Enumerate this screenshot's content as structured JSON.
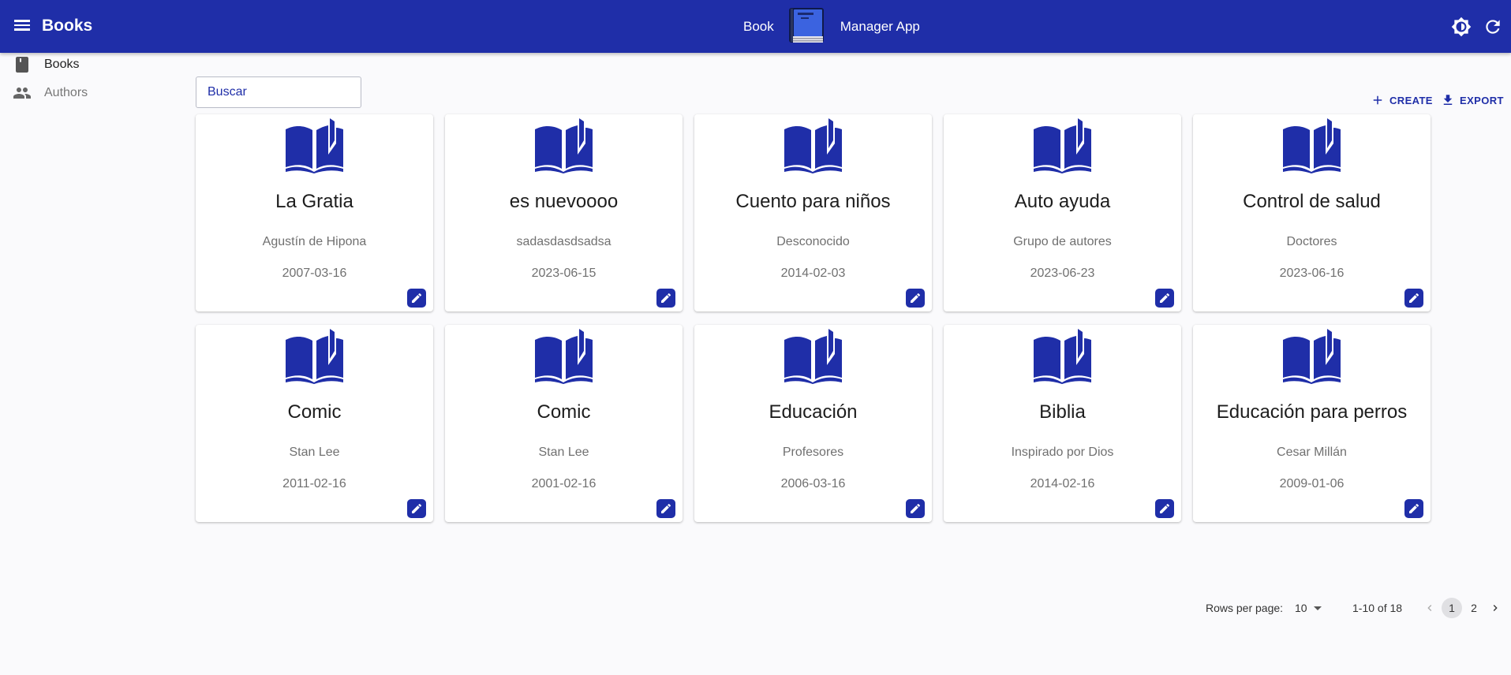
{
  "appbar": {
    "title": "Books",
    "center_left": "Book",
    "center_right": "Manager App",
    "icons": [
      "menu-icon",
      "book-logo-icon",
      "brightness-icon",
      "refresh-icon"
    ],
    "color": "#1f2ea8"
  },
  "sidebar": {
    "items": [
      {
        "label": "Books",
        "icon": "book-icon",
        "active": true
      },
      {
        "label": "Authors",
        "icon": "people-icon",
        "active": false
      }
    ]
  },
  "search": {
    "placeholder": "Buscar"
  },
  "toolbar": {
    "create_label": "CREATE",
    "export_label": "EXPORT"
  },
  "books": [
    {
      "title": "La Gratia",
      "author": "Agustín de Hipona",
      "date": "2007-03-16"
    },
    {
      "title": "es nuevoooo",
      "author": "sadasdasdsadsa",
      "date": "2023-06-15"
    },
    {
      "title": "Cuento para niños",
      "author": "Desconocido",
      "date": "2014-02-03"
    },
    {
      "title": "Auto ayuda",
      "author": "Grupo de autores",
      "date": "2023-06-23"
    },
    {
      "title": "Control de salud",
      "author": "Doctores",
      "date": "2023-06-16"
    },
    {
      "title": "Comic",
      "author": "Stan Lee",
      "date": "2011-02-16"
    },
    {
      "title": "Comic",
      "author": "Stan Lee",
      "date": "2001-02-16"
    },
    {
      "title": "Educación",
      "author": "Profesores",
      "date": "2006-03-16"
    },
    {
      "title": "Biblia",
      "author": "Inspirado por Dios",
      "date": "2014-02-16"
    },
    {
      "title": "Educación para perros",
      "author": "Cesar Millán",
      "date": "2009-01-06"
    }
  ],
  "pagination": {
    "rows_per_page_label": "Rows per page:",
    "rows_per_page": "10",
    "range": "1-10 of 18",
    "pages": [
      "1",
      "2"
    ],
    "current_page": "1"
  }
}
